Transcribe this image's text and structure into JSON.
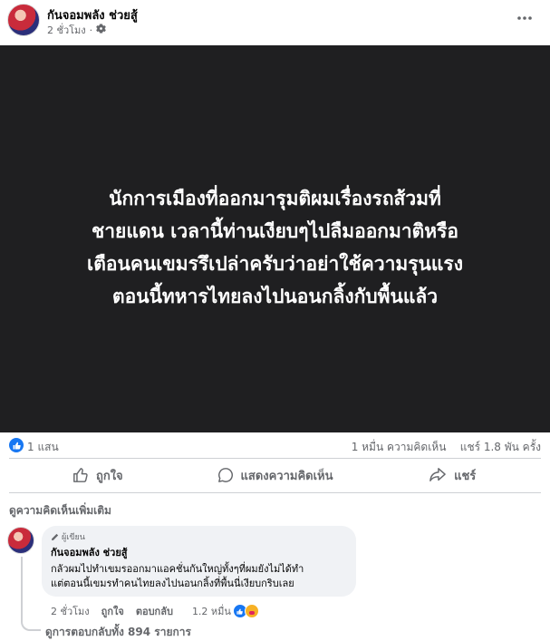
{
  "post": {
    "page_name": "กันจอมพลัง ช่วยสู้",
    "time": "2 ชั่วโมง",
    "dot": "·",
    "privacy_icon": "gear-icon",
    "more_icon": "more-dots-icon",
    "image_text_lines": [
      "นักการเมืองที่ออกมารุมติผมเรื่องรถส้วมที่",
      "ชายแดน เวลานี้ท่านเงียบๆไปลืมออกมาติหรือ",
      "เตือนคนเขมรรึเปล่าครับว่าอย่าใช้ความรุนแรง",
      "ตอนนี้ทหารไทยลงไปนอนกลิ้งกับพื้นแล้ว"
    ]
  },
  "stats": {
    "likes": "1 แสน",
    "comments": "1 หมื่น ความคิดเห็น",
    "shares": "แชร์ 1.8 พัน ครั้ง"
  },
  "actions": {
    "like": "ถูกใจ",
    "comment": "แสดงความคิดเห็น",
    "share": "แชร์"
  },
  "comments_section": {
    "more_label": "ดูความคิดเห็นเพิ่มเติม",
    "comment": {
      "badge": "ผู้เขียน",
      "name": "กันจอมพลัง ช่วยสู้",
      "lines": [
        "กลัวผมไปทำเขมรออกมาแอคชั่นกันใหญ่ทั้งๆที่ผมยังไม่ได้ทำ",
        "แต่ตอนนี้เขมรทำคนไทยลงไปนอนกลิ้งที่พื้นนี่เงียบกริบเลย"
      ],
      "time": "2 ชั่วโมง",
      "like_label": "ถูกใจ",
      "reply_label": "ตอบกลับ",
      "reaction_count": "1.2 หมื่น"
    },
    "view_replies": "ดูการตอบกลับทั้ง 894 รายการ"
  },
  "colors": {
    "brand_blue": "#1877f2",
    "secondary_text": "#65676b",
    "image_bg": "#1f1f21"
  }
}
